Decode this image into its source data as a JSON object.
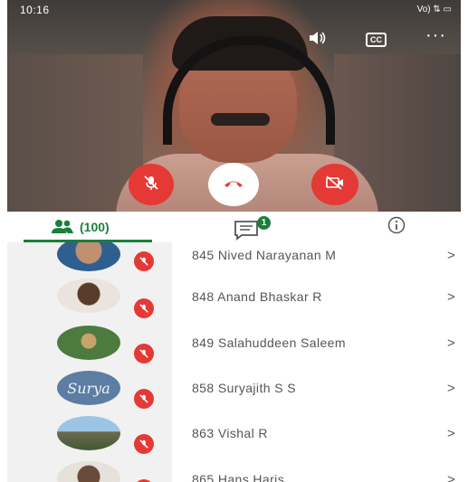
{
  "status_bar": {
    "time": "10:16",
    "right": "Vo) ⇅ ▭"
  },
  "tabs": {
    "participants_count": "(100)",
    "chat_badge": "1"
  },
  "participants": [
    {
      "name": "845 Nived Narayanan M",
      "chevron": ">"
    },
    {
      "name": "848 Anand Bhaskar R",
      "chevron": ">"
    },
    {
      "name": "849 Salahuddeen Saleem",
      "chevron": ">"
    },
    {
      "name": "858 Suryajith S S",
      "chevron": ">"
    },
    {
      "name": "863 Vishal R",
      "chevron": ">"
    },
    {
      "name": "865 Hans Haris",
      "chevron": ">"
    }
  ],
  "avatar_text": "Surya",
  "colors": {
    "accent": "#1a7f3a",
    "mute_red": "#e53935"
  },
  "icons": {
    "speaker": "speaker-icon",
    "cc": "closed-captions-icon",
    "more": "more-icon",
    "mic_off": "mic-off-icon",
    "end_call": "end-call-icon",
    "video_off": "video-off-icon",
    "people": "people-icon",
    "chat": "chat-icon",
    "info": "info-icon"
  }
}
